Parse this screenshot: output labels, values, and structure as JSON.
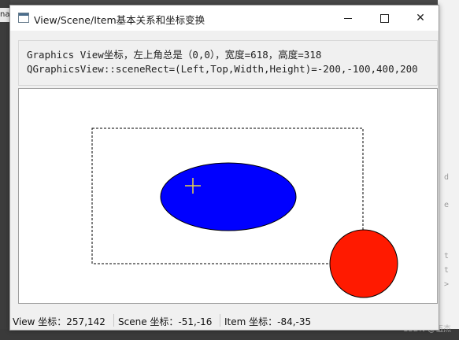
{
  "window": {
    "title": "View/Scene/Item基本关系和坐标变换",
    "icon": "app-window-icon",
    "controls": {
      "minimize_icon": "minimize-icon",
      "maximize_icon": "maximize-icon",
      "close_glyph": "✕"
    }
  },
  "info": {
    "line1": "Graphics View坐标，左上角总是（0,0），宽度=618，高度=318",
    "line2": "QGraphicsView::sceneRect=(Left,Top,Width,Height)=-200,-100,400,200"
  },
  "scene": {
    "rect_border": "dashed",
    "ellipse_color": "#0000ff",
    "circle_color": "#ff1a00",
    "crosshair_color": "#e8d24a"
  },
  "statusbar": {
    "view_coord": "View 坐标：257,142",
    "scene_coord": "Scene 坐标：-51,-16",
    "item_coord": "Item 坐标：-84,-35"
  },
  "background": {
    "left_tab": "nal",
    "watermark": "CSDN @伍杰"
  }
}
